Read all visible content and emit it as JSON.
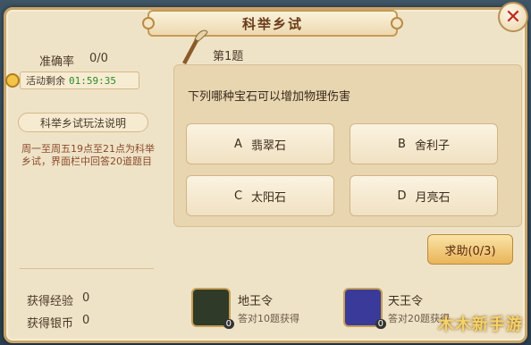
{
  "window": {
    "title": "科举乡试"
  },
  "stats": {
    "accuracy_label": "准确率",
    "accuracy_value": "0/0",
    "time_label": "活动剩余",
    "time_value": "01:59:35",
    "rules_title": "科举乡试玩法说明",
    "rules_text": "周一至周五19点至21点为科举乡试，界面栏中回答20道题目",
    "exp_label": "获得经验",
    "exp_value": "0",
    "silver_label": "获得银币",
    "silver_value": "0"
  },
  "question": {
    "number": "第1题",
    "text": "下列哪种宝石可以增加物理伤害",
    "options": [
      {
        "letter": "A",
        "text": "翡翠石"
      },
      {
        "letter": "B",
        "text": "舍利子"
      },
      {
        "letter": "C",
        "text": "太阳石"
      },
      {
        "letter": "D",
        "text": "月亮石"
      }
    ],
    "help_label": "求助(0/3)"
  },
  "rewards": [
    {
      "name": "地王令",
      "desc": "答对10题获得",
      "count": "0",
      "color": "#2f3b28"
    },
    {
      "name": "天王令",
      "desc": "答对20题获得",
      "count": "0",
      "color": "#3a3a9a"
    }
  ],
  "icons": {
    "close": "close-icon",
    "timer": "clock-icon",
    "brush": "brush-icon"
  },
  "watermark": "木木新手游"
}
